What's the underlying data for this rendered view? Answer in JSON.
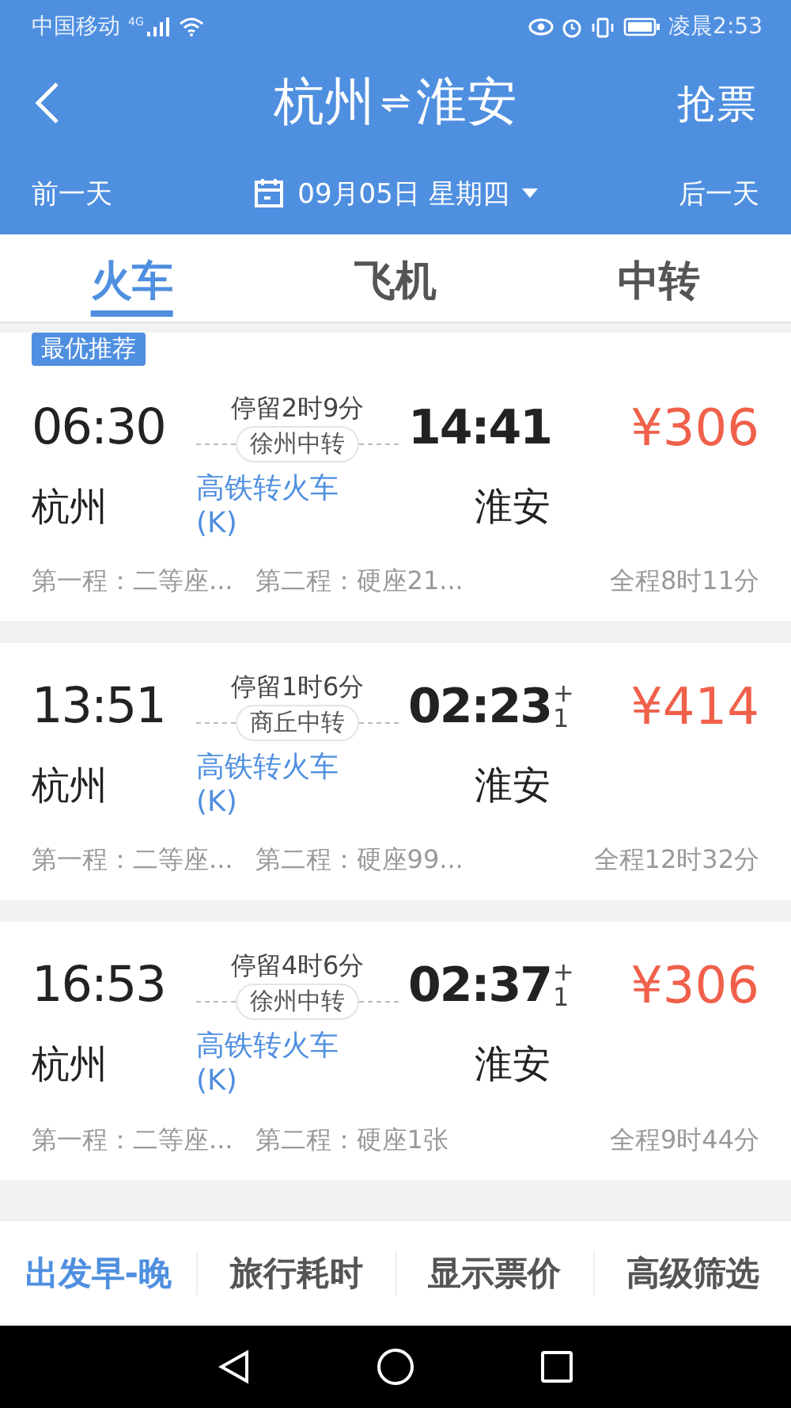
{
  "status_bar": {
    "carrier": "中国移动",
    "network": "4G",
    "time": "凌晨2:53"
  },
  "header": {
    "from": "杭州",
    "to": "淮安",
    "action": "抢票"
  },
  "date_bar": {
    "prev": "前一天",
    "date": "09月05日 星期四",
    "next": "后一天"
  },
  "tabs": [
    {
      "label": "火车",
      "selected": true
    },
    {
      "label": "飞机",
      "selected": false
    },
    {
      "label": "中转",
      "selected": false
    }
  ],
  "results": [
    {
      "badge": "最优推荐",
      "depart": "06:30",
      "stopover": "停留2时9分",
      "transfer": "徐州中转",
      "arrive": "14:41",
      "price": "¥306",
      "from": "杭州",
      "mode": "高铁转火车(K)",
      "to": "淮安",
      "leg1": "第一程：二等座...",
      "leg2": "第二程：硬座21...",
      "total": "全程8时11分"
    },
    {
      "depart": "13:51",
      "stopover": "停留1时6分",
      "transfer": "商丘中转",
      "arrive": "02:23",
      "day_offset": "+1",
      "price": "¥414",
      "from": "杭州",
      "mode": "高铁转火车(K)",
      "to": "淮安",
      "leg1": "第一程：二等座...",
      "leg2": "第二程：硬座99...",
      "total": "全程12时32分"
    },
    {
      "depart": "16:53",
      "stopover": "停留4时6分",
      "transfer": "徐州中转",
      "arrive": "02:37",
      "day_offset": "+1",
      "price": "¥306",
      "from": "杭州",
      "mode": "高铁转火车(K)",
      "to": "淮安",
      "leg1": "第一程：二等座...",
      "leg2": "第二程：硬座1张",
      "total": "全程9时44分"
    }
  ],
  "sort_bar": [
    {
      "label": "出发早-晚",
      "selected": true
    },
    {
      "label": "旅行耗时",
      "selected": false
    },
    {
      "label": "显示票价",
      "selected": false
    },
    {
      "label": "高级筛选",
      "selected": false
    }
  ]
}
